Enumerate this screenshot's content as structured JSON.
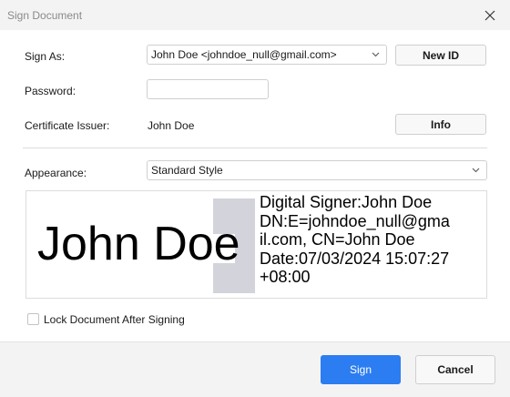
{
  "window": {
    "title": "Sign Document",
    "close_icon": "close-icon"
  },
  "form": {
    "sign_as_label": "Sign As:",
    "sign_as_value": "John Doe <johndoe_null@gmail.com>",
    "new_id_label": "New ID",
    "password_label": "Password:",
    "password_value": "",
    "cert_issuer_label": "Certificate Issuer:",
    "cert_issuer_value": "John Doe",
    "info_label": "Info",
    "appearance_label": "Appearance:",
    "appearance_value": "Standard Style"
  },
  "preview": {
    "name": "John Doe",
    "lines": [
      "Digital Signer:John Doe",
      "DN:E=johndoe_null@gma",
      "il.com, CN=John Doe",
      "Date:07/03/2024 15:07:27",
      "+08:00"
    ]
  },
  "lock": {
    "label": "Lock Document After Signing",
    "checked": false
  },
  "footer": {
    "sign_label": "Sign",
    "cancel_label": "Cancel"
  },
  "colors": {
    "primary": "#2b7df1",
    "window_bg": "#f3f3f3",
    "content_bg": "#ffffff",
    "preview_block": "#d3d3db"
  }
}
